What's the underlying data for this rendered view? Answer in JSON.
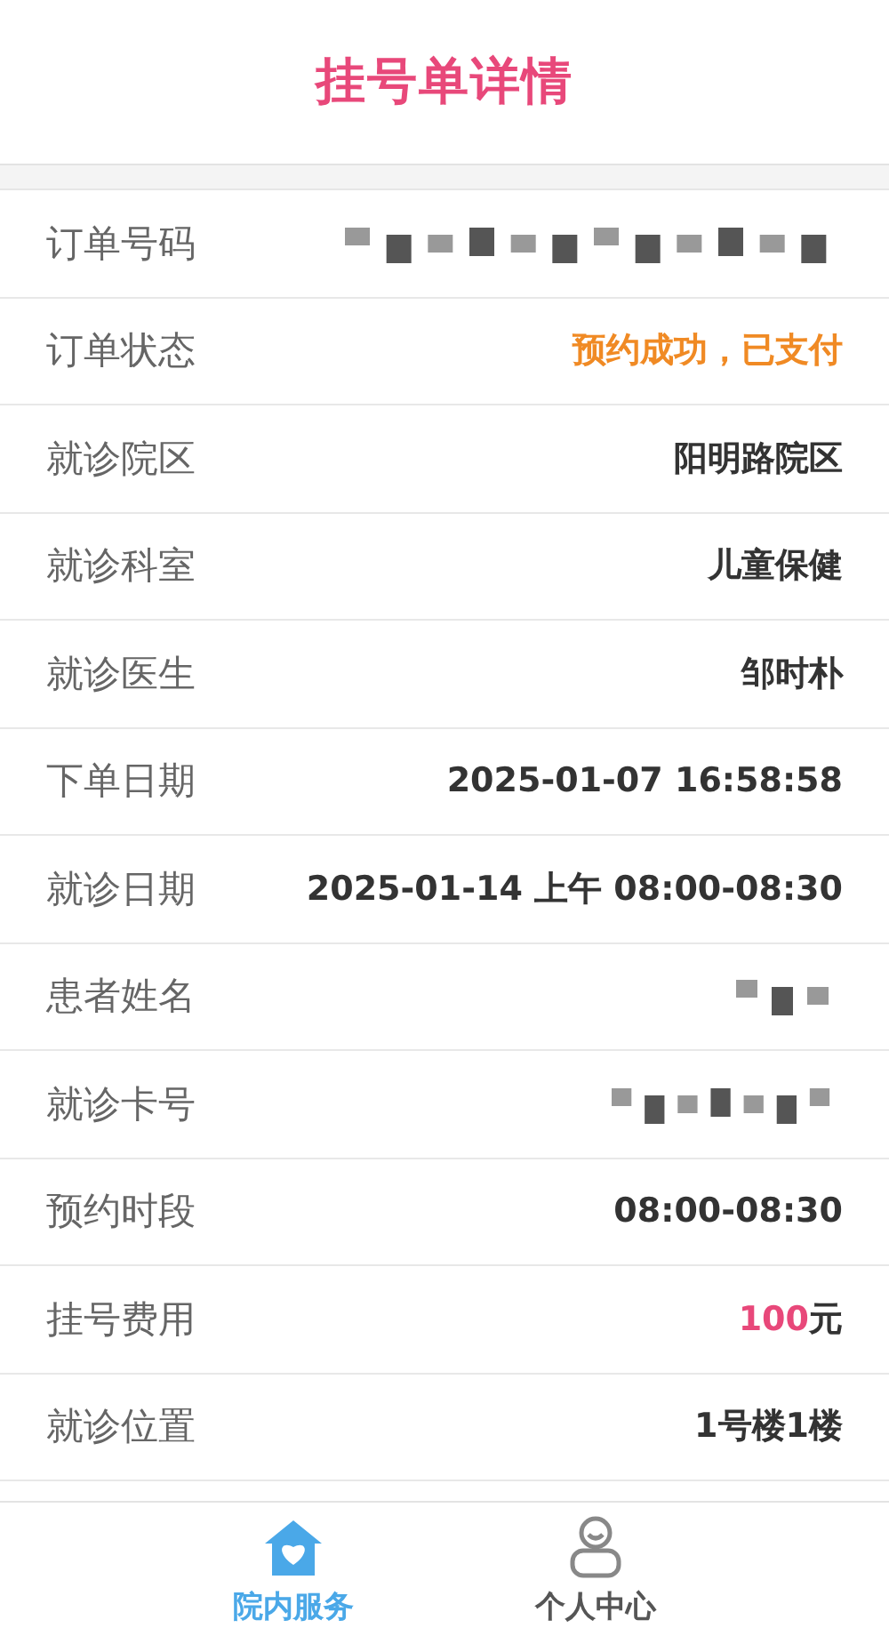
{
  "header": {
    "title": "挂号单详情"
  },
  "rows": [
    {
      "label": "订单号码",
      "kind": "redacted"
    },
    {
      "label": "订单状态",
      "kind": "status",
      "value": "预约成功，已支付"
    },
    {
      "label": "就诊院区",
      "kind": "text",
      "value": "阳明路院区"
    },
    {
      "label": "就诊科室",
      "kind": "text",
      "value": "儿童保健"
    },
    {
      "label": "就诊医生",
      "kind": "text",
      "value": "邹时朴"
    },
    {
      "label": "下单日期",
      "kind": "text",
      "value": "2025-01-07 16:58:58"
    },
    {
      "label": "就诊日期",
      "kind": "text",
      "value": "2025-01-14 上午 08:00-08:30"
    },
    {
      "label": "患者姓名",
      "kind": "redacted"
    },
    {
      "label": "就诊卡号",
      "kind": "redacted"
    },
    {
      "label": "预约时段",
      "kind": "text",
      "value": "08:00-08:30"
    },
    {
      "label": "挂号费用",
      "kind": "fee",
      "amount": "100",
      "unit": "元"
    },
    {
      "label": "就诊位置",
      "kind": "text",
      "value": "1号楼1楼"
    }
  ],
  "nav": [
    {
      "label": "院内服务",
      "kind": "home",
      "selected": true
    },
    {
      "label": "个人中心",
      "kind": "person",
      "selected": false
    }
  ]
}
